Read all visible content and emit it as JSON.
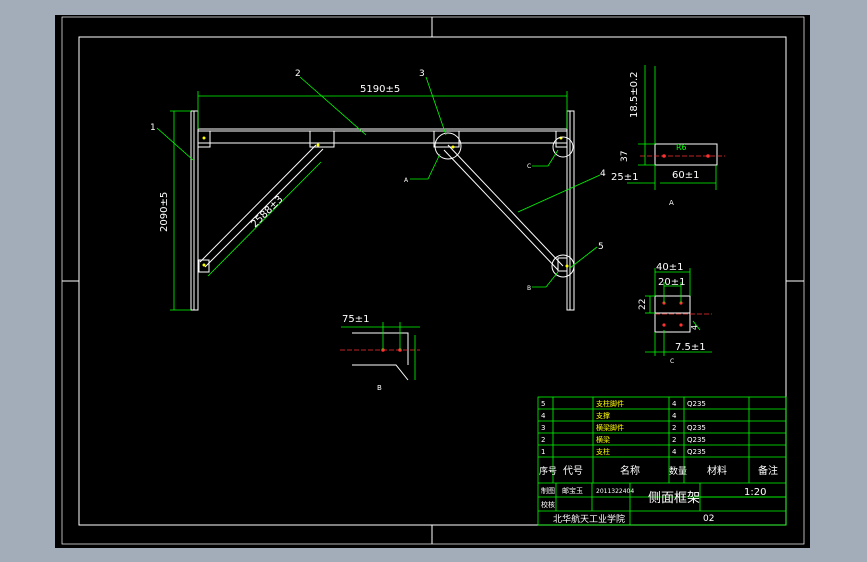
{
  "drawing": {
    "main_dims": {
      "width": "5190±5",
      "height": "2090±5",
      "brace": "2588±3"
    },
    "part_refs": [
      "1",
      "2",
      "3",
      "4",
      "5"
    ],
    "detail_callouts": [
      "A",
      "B",
      "C"
    ]
  },
  "detail_a": {
    "label": "A",
    "dims": {
      "thickness": "18.5±0.2",
      "height": "37",
      "offset": "25±1",
      "length": "60±1",
      "radius": "R6"
    }
  },
  "detail_b": {
    "label": "B",
    "dims": {
      "pitch": "75±1"
    }
  },
  "detail_c": {
    "label": "C",
    "dims": {
      "outer": "40±1",
      "inner": "20±1",
      "height": "22",
      "edge": "7.5±1",
      "hole": "4"
    }
  },
  "title_block": {
    "bom_rows": [
      {
        "no": "5",
        "name": "支柱脚件",
        "qty": "4",
        "material": "Q235"
      },
      {
        "no": "4",
        "name": "支撑",
        "qty": "4",
        "material": ""
      },
      {
        "no": "3",
        "name": "横梁脚件",
        "qty": "2",
        "material": "Q235"
      },
      {
        "no": "2",
        "name": "横梁",
        "qty": "2",
        "material": "Q235"
      },
      {
        "no": "1",
        "name": "支柱",
        "qty": "4",
        "material": "Q235"
      }
    ],
    "bom_header": {
      "no": "序号",
      "code": "代号",
      "name": "名称",
      "qty": "数量",
      "material": "材料",
      "remark": "备注"
    },
    "draw_label": "制图",
    "author": "邮宝玉",
    "student_id": "2011322404",
    "check_label": "校核",
    "title": "侧面框架",
    "scale": "1:20",
    "school": "北华航天工业学院",
    "sheet": "02"
  }
}
